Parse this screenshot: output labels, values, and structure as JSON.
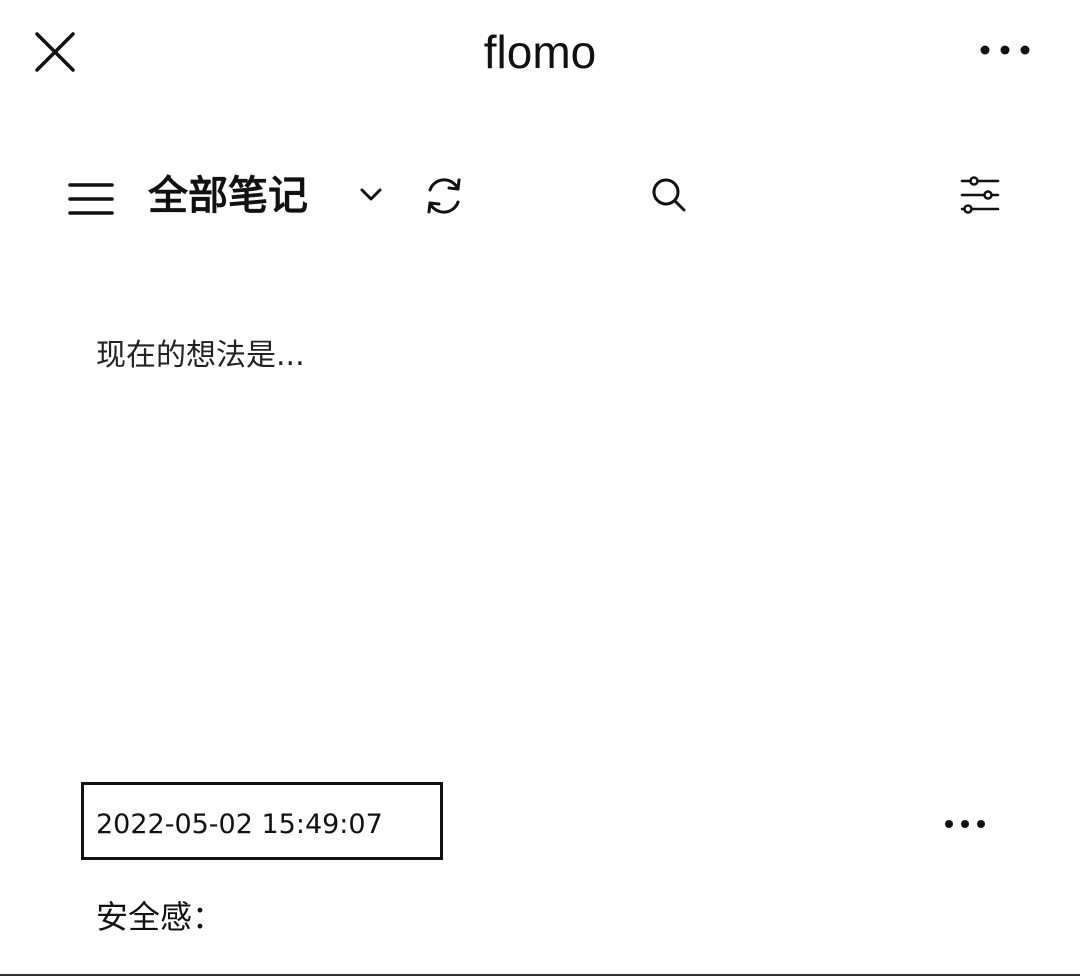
{
  "header": {
    "title": "flomo",
    "close_icon": "close-icon",
    "more_icon": "more-horizontal-icon"
  },
  "toolbar": {
    "notes_title": "全部笔记",
    "icons": [
      "menu-icon",
      "chevron-down-icon",
      "sync-icon",
      "search-icon",
      "filter-sliders-icon"
    ]
  },
  "composer": {
    "placeholder": "现在的想法是..."
  },
  "memo": {
    "timestamp": "2022-05-02 15:49:07",
    "content": "安全感：",
    "more_icon": "more-horizontal-icon"
  },
  "colors": {
    "background": "#ffffff",
    "foreground": "#111111"
  }
}
